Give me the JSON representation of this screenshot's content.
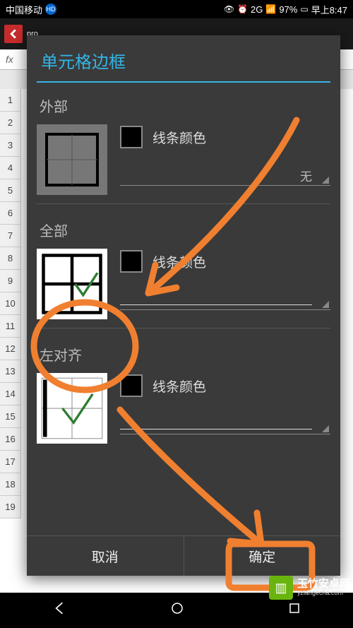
{
  "status": {
    "carrier": "中国移动",
    "hd_badge": "HD",
    "network": "2G",
    "battery": "97%",
    "time": "早上8:47"
  },
  "background": {
    "fx_label": "fx",
    "row_count": 19
  },
  "dialog": {
    "title": "单元格边框",
    "sections": {
      "outer": {
        "title": "外部",
        "color_label": "线条颜色",
        "style_label": "无"
      },
      "all": {
        "title": "全部",
        "color_label": "线条颜色",
        "style_label": ""
      },
      "left": {
        "title": "左对齐",
        "color_label": "线条颜色",
        "style_label": ""
      }
    },
    "buttons": {
      "cancel": "取消",
      "ok": "确定"
    }
  },
  "watermark": {
    "name": "玉竹安卓网",
    "url": "yzlangecha.com"
  }
}
